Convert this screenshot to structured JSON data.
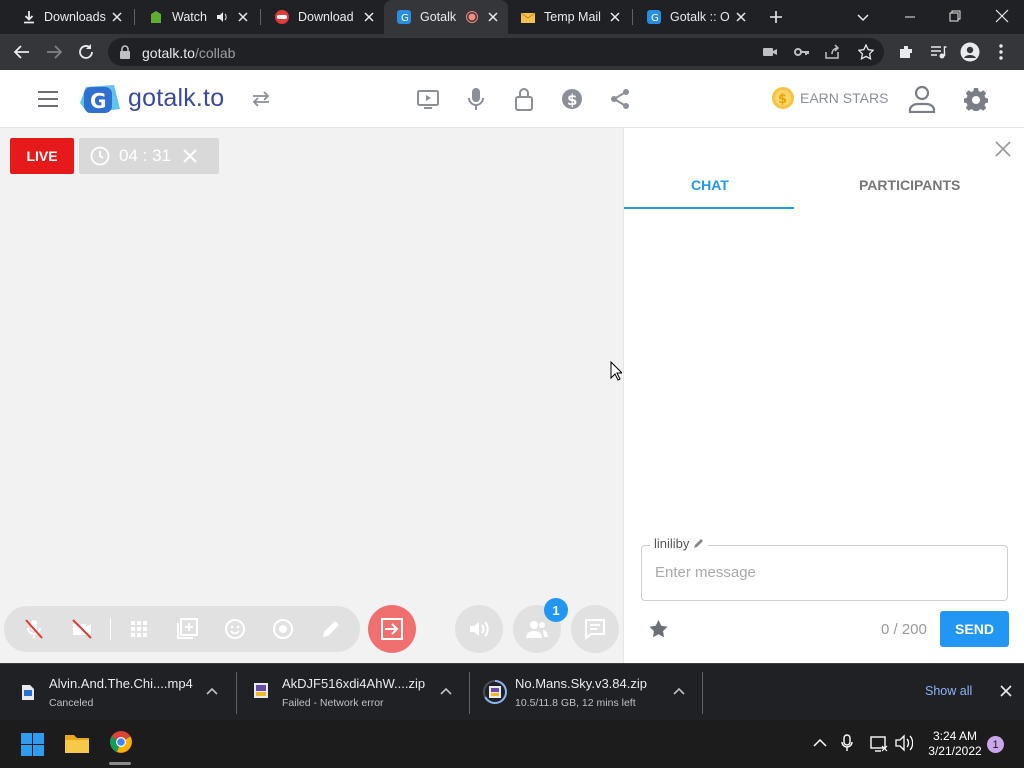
{
  "browser": {
    "tabs": [
      {
        "title": "Downloads",
        "icon": "download-icon"
      },
      {
        "title": "Watch",
        "icon": "site-favicon"
      },
      {
        "title": "Download",
        "icon": "site-favicon"
      },
      {
        "title": "Gotalk",
        "icon": "gotalk-favicon",
        "active": true
      },
      {
        "title": "Temp Mail",
        "icon": "mail-favicon"
      },
      {
        "title": "Gotalk :: O",
        "icon": "gotalk-favicon"
      }
    ],
    "url_host": "gotalk.to",
    "url_path": "/collab"
  },
  "site": {
    "logo_text": "gotalk.to",
    "earn_stars": "EARN STARS"
  },
  "stage": {
    "live_label": "LIVE",
    "timer": "04 : 31"
  },
  "chat": {
    "tab_chat": "CHAT",
    "tab_participants": "PARTICIPANTS",
    "username": "liniliby",
    "placeholder": "Enter message",
    "counter": "0 / 200",
    "send_label": "SEND"
  },
  "participants_badge": "1",
  "downloads": {
    "items": [
      {
        "name": "Alvin.And.The.Chi....mp4",
        "status": "Canceled"
      },
      {
        "name": "AkDJF516xdi4AhW....zip",
        "status": "Failed - Network error"
      },
      {
        "name": "No.Mans.Sky.v3.84.zip",
        "status": "10.5/11.8 GB, 12 mins left"
      }
    ],
    "show_all": "Show all"
  },
  "taskbar": {
    "time": "3:24 AM",
    "date": "3/21/2022",
    "notification_count": "1"
  },
  "colors": {
    "live_red": "#e61a1a",
    "accent_blue": "#2196f3",
    "leave_button": "#f06f6f",
    "logo_blue": "#3a4a9f"
  }
}
